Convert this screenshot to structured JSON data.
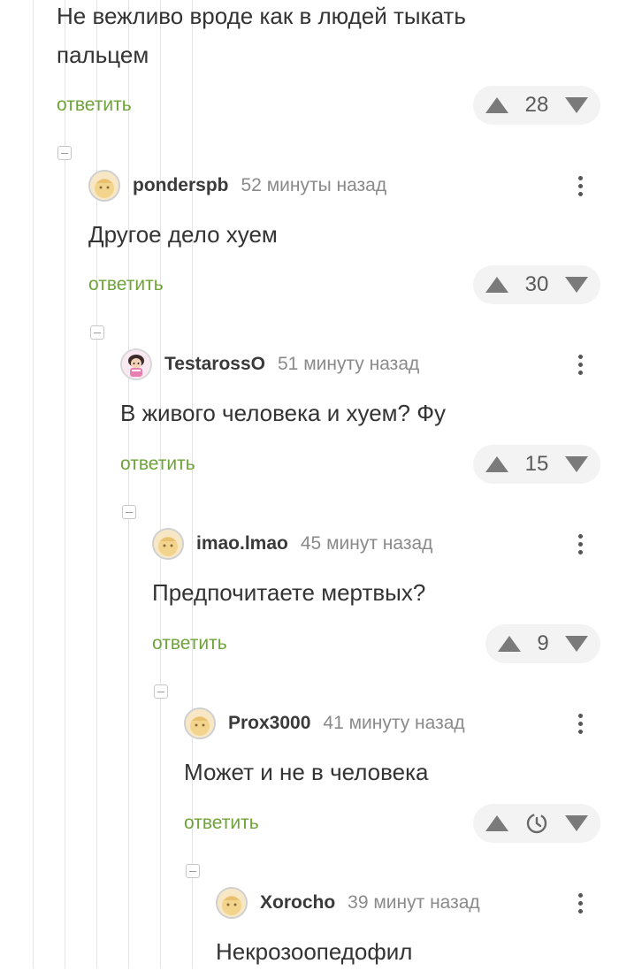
{
  "top_comment": {
    "text_lines": [
      "Не вежливо вроде как в людей тыкать",
      "пальцем"
    ],
    "reply_label": "ответить",
    "score": "28"
  },
  "comments": [
    {
      "username": "ponderspb",
      "time": "52 минуты назад",
      "text": "Другое дело хуем",
      "reply_label": "ответить",
      "score": "30",
      "avatar": "default-avatar-icon"
    },
    {
      "username": "TestarossO",
      "time": "51 минуту назад",
      "text": "В живого человека и хуем? Фу",
      "reply_label": "ответить",
      "score": "15",
      "avatar": "cartoon-character-avatar"
    },
    {
      "username": "imao.lmao",
      "time": "45 минут назад",
      "text": "Предпочитаете мертвых?",
      "reply_label": "ответить",
      "score": "9",
      "avatar": "default-avatar-icon"
    },
    {
      "username": "Prox3000",
      "time": "41 минуту назад",
      "text": "Может и не в человека",
      "reply_label": "ответить",
      "score": "",
      "score_pending_icon": "clock-icon",
      "avatar": "default-avatar-icon"
    },
    {
      "username": "Xorocho",
      "time": "39 минут назад",
      "text": "Некрозоопедофил",
      "avatar": "default-avatar-icon"
    }
  ],
  "colors": {
    "reply": "#6ea33a",
    "thread_line": "#e4e4e4",
    "vote_bg": "#f3f3f3",
    "arrow": "#7a7a7a"
  }
}
